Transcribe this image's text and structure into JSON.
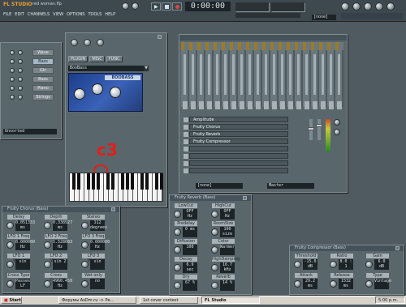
{
  "app": {
    "logo": "FL STUDIO",
    "file_name": "red woman.flp",
    "menu": [
      "FILE",
      "EDIT",
      "CHANNELS",
      "VIEW",
      "OPTIONS",
      "TOOLS",
      "HELP"
    ],
    "time": "0:00:00",
    "pattern_selector": "[none]"
  },
  "channel_rack": {
    "channels": [
      "Wave",
      "Bass",
      "Gtr",
      "Bass",
      "Piano",
      "Strings"
    ],
    "filter": "Unsorted"
  },
  "plugin_window": {
    "tabs": [
      "PLUGIN",
      "MISC",
      "FUNC"
    ],
    "preset": "BooBass",
    "plugin_name": "BOOBASS",
    "note_annotation": "c3"
  },
  "mixer": {
    "effect_slots": [
      "Amplitude",
      "Fruity Chorus",
      "Fruity Reverb",
      "Fruity Compressor",
      "",
      "",
      "",
      ""
    ],
    "input_label": "[none]",
    "output_label": "Master"
  },
  "fruity_chorus": {
    "title": "Fruity Chorus (Bass)",
    "params": [
      {
        "label": "Delay",
        "value": "0.051333 ms"
      },
      {
        "label": "Depth",
        "value": "0.338927 ms"
      },
      {
        "label": "Stereo",
        "value": "112 degrees"
      },
      {
        "label": "LFO 1 Freq",
        "value": "0.000000 Hz"
      },
      {
        "label": "LFO 2 Freq",
        "value": "5.528083 Hz"
      },
      {
        "label": "LFO 3 Freq",
        "value": "0.000000 Hz"
      },
      {
        "label": "LFO 1 Wave",
        "value": "sin"
      },
      {
        "label": "LFO 2 Wave",
        "value": "sin 2"
      },
      {
        "label": "LFO 3 Wave",
        "value": "sin"
      },
      {
        "label": "Cross Type",
        "value": "Passes LF"
      },
      {
        "label": "Cross Cutoff",
        "value": "4960.458 Hz"
      },
      {
        "label": "Wet only",
        "value": "no"
      }
    ]
  },
  "fruity_reverb": {
    "title": "Fruity Reverb (Bass)",
    "params": [
      {
        "label": "LowCut",
        "value": "OFF Hz"
      },
      {
        "label": "HighCut",
        "value": "OFF Hz"
      },
      {
        "label": "Predelay",
        "value": "0 ms"
      },
      {
        "label": "RoomSize",
        "value": "100 size"
      },
      {
        "label": "Diffusion",
        "value": "100"
      },
      {
        "label": "Color",
        "value": "Warmer"
      },
      {
        "label": "Decay",
        "value": "6.9 sec"
      },
      {
        "label": "HighDamping",
        "value": "16.7 kHz"
      },
      {
        "label": "Dry",
        "value": "67 %"
      },
      {
        "label": "Reverb",
        "value": "14 %"
      }
    ]
  },
  "fruity_compressor": {
    "title": "Fruity Compressor (Bass)",
    "params": [
      {
        "label": "Threshold",
        "value": "-15.0 dB"
      },
      {
        "label": "Ratio",
        "value": "8.0 : 1"
      },
      {
        "label": "Gain",
        "value": "6.0 dB"
      },
      {
        "label": "Attack",
        "value": "29.2 ms"
      },
      {
        "label": "Release",
        "value": "1532 ms"
      },
      {
        "label": "Type",
        "value": "Vintage"
      }
    ]
  },
  "taskbar": {
    "start": "Start",
    "tasks": [
      "Форумы AsDm.ru -> Ре...",
      "1st cover contest",
      "FL Studio"
    ],
    "clock": "5:00 p.m."
  },
  "colors": {
    "annotation": "#e0201a",
    "lcd_bg": "#1d2427",
    "desktop": "#4f5b61"
  }
}
